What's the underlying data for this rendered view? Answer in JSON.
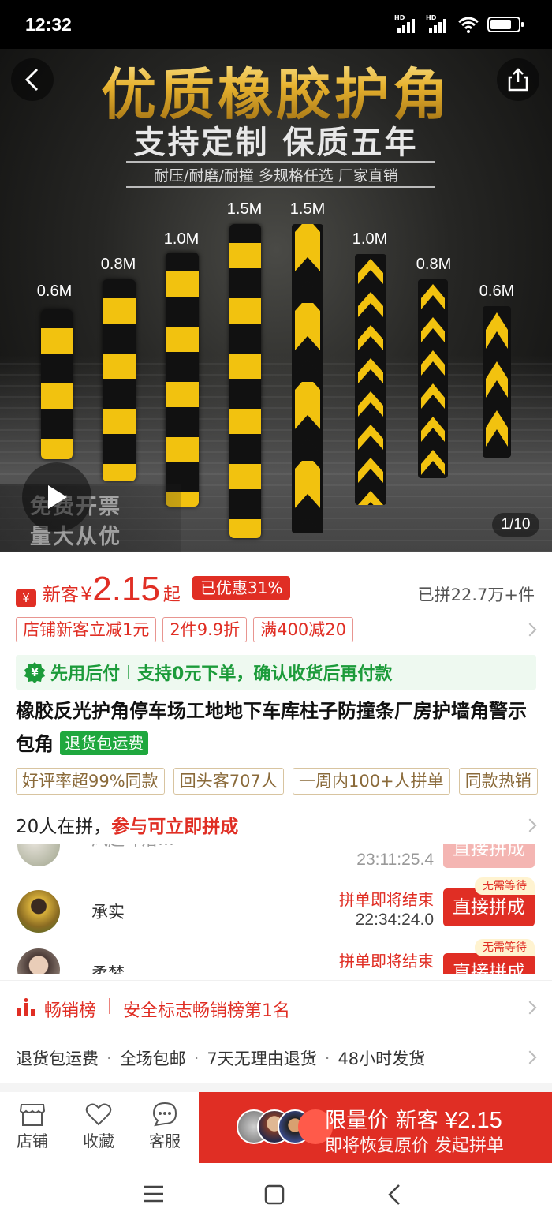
{
  "status_bar": {
    "time": "12:32",
    "signal_labels": [
      "HD",
      "HD"
    ],
    "battery_level": 0.8
  },
  "hero": {
    "title": "优质橡胶护角",
    "subtitle": "支持定制  保质五年",
    "features": "耐压/耐磨/耐撞  多规格任选  厂家直销",
    "post_lengths": [
      "0.6M",
      "0.8M",
      "1.0M",
      "1.5M",
      "1.5M",
      "1.0M",
      "0.8M",
      "0.6M"
    ],
    "promo_lines": [
      "免费开票",
      "量大从优"
    ],
    "counter": "1/10"
  },
  "price": {
    "new_customer_label": "新客",
    "currency": "¥",
    "amount": "2.15",
    "suffix": "起",
    "discount_badge": "已优惠31%",
    "sold": "已拼22.7万+件",
    "coupons": [
      "店铺新客立减1元",
      "2件9.9折",
      "满400减20"
    ]
  },
  "pay_later": {
    "title": "先用后付",
    "desc": "支持0元下单，确认收货后再付款"
  },
  "product": {
    "title": "橡胶反光护角停车场工地地下车库柱子防撞条厂房护墙角警示包角",
    "return_badge": "退货包运费",
    "tags": [
      "好评率超99%同款",
      "回头客707人",
      "一周内100+人拼单",
      "同款热销"
    ]
  },
  "group_buy": {
    "count_text": "20人在拼，",
    "join_text": "参与可立即拼成",
    "rows": [
      {
        "name": "风起叶落…",
        "status": "",
        "time": "23:11:25.4",
        "button": "直接拼成",
        "badge": ""
      },
      {
        "name": "承实",
        "status": "拼单即将结束",
        "time": "22:34:24.0",
        "button": "直接拼成",
        "badge": "无需等待"
      },
      {
        "name": "柔梦",
        "status": "拼单即将结束",
        "time": "",
        "button": "直接拼成",
        "badge": "无需等待"
      }
    ]
  },
  "ranking": {
    "label": "畅销榜",
    "detail": "安全标志畅销榜第1名"
  },
  "services": [
    "退货包运费",
    "全场包邮",
    "7天无理由退货",
    "48小时发货"
  ],
  "bottom_bar": {
    "shop": "店铺",
    "favorite": "收藏",
    "service": "客服",
    "buy_line1_prefix": "限量价  新客 ",
    "buy_line1_amount": "¥2.15",
    "buy_line2": "即将恢复原价 发起拼单"
  },
  "colors": {
    "accent": "#e02e24",
    "green": "#1c9b3a",
    "gold": "#e6b12e"
  }
}
